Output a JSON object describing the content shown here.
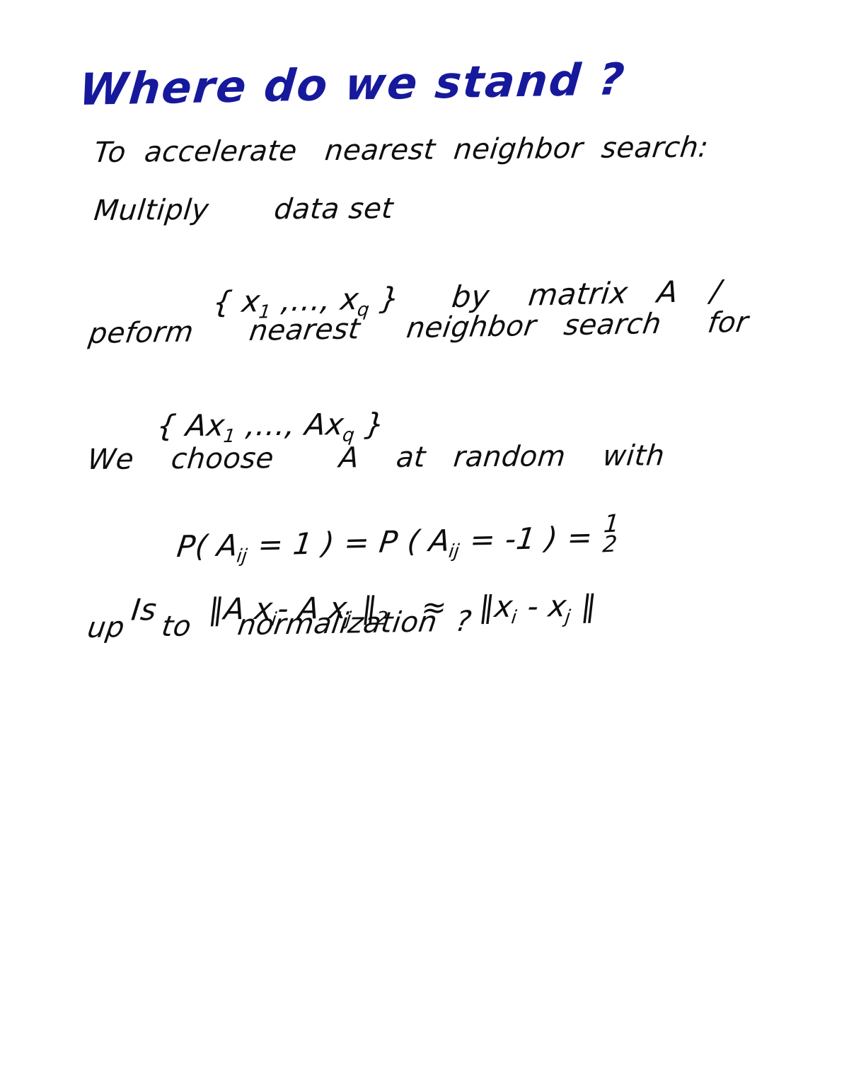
{
  "document": {
    "kind": "handwritten-lecture-notes",
    "background_color": "#ffffff",
    "title_ink_color": "#17199c",
    "body_ink_color": "#0d0d0d",
    "title": "Where do we stand ?",
    "lines": [
      {
        "id": "line-1",
        "text": "To  accelerate   nearest  neighbor  search:"
      },
      {
        "id": "line-2",
        "text": "Multiply       data set"
      },
      {
        "id": "line-3",
        "prefix": "{ x",
        "sub1": "1",
        "mid": " ,..., x",
        "sub2": "q",
        "suffix": " }",
        "tail": "by    matrix   A",
        "comma": "/"
      },
      {
        "id": "line-4",
        "text": "peform      nearest     neighbor   search     for"
      },
      {
        "id": "line-5",
        "prefix": "{ Ax",
        "sub1": "1",
        "mid": " ,..., Ax",
        "sub2": "q",
        "suffix": " }"
      },
      {
        "id": "line-6",
        "text": "We    choose       A    at   random    with"
      },
      {
        "id": "line-7",
        "p1": "P( A",
        "sub1": "ij",
        "p2": " = 1 ) = P ( A",
        "sub2": "ij",
        "p3": " = -1 ) = ",
        "frac_num": "1",
        "frac_den": "2"
      },
      {
        "id": "line-8",
        "p1": "Is",
        "p2": "‖A x",
        "sub1": "i",
        "p3": "- A x",
        "sub2": "j",
        "p4": " ‖",
        "sub3": "2",
        "p5": "≈",
        "p6": "‖x",
        "sub4": "i",
        "p7": " - x",
        "sub5": "j",
        "p8": " ‖"
      },
      {
        "id": "line-9",
        "text": "up    to     normalization  ?"
      }
    ]
  }
}
